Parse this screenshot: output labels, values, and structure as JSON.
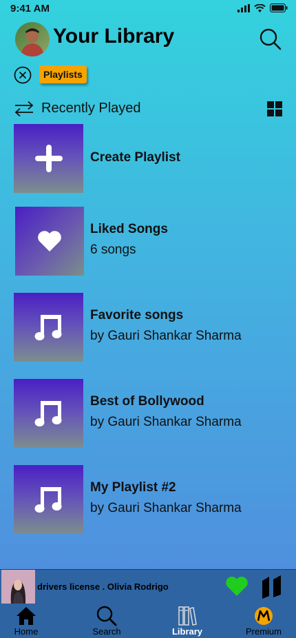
{
  "status_bar": {
    "time": "9:41 AM"
  },
  "header": {
    "title": "Your Library",
    "avatar_icon": "user-avatar",
    "search_icon": "search-icon"
  },
  "filter": {
    "chip_label": "Playlists",
    "clear_icon": "close-circle-icon"
  },
  "sort": {
    "label": "Recently Played",
    "sort_icon": "swap-arrows-icon",
    "view_icon": "grid-view-icon"
  },
  "library_items": [
    {
      "name": "Create Playlist",
      "subtitle": "",
      "icon": "plus-icon"
    },
    {
      "name": "Liked Songs",
      "subtitle": "6 songs",
      "icon": "heart-icon"
    },
    {
      "name": "Favorite songs",
      "subtitle": "by Gauri Shankar Sharma",
      "icon": "music-note-icon"
    },
    {
      "name": "Best of Bollywood",
      "subtitle": "by Gauri Shankar Sharma",
      "icon": "music-note-icon"
    },
    {
      "name": "My Playlist #2",
      "subtitle": "by Gauri Shankar Sharma",
      "icon": "music-note-icon"
    }
  ],
  "now_playing": {
    "track": "drivers license . Olivia Rodrigo",
    "liked": true,
    "like_color": "#1fcc1f"
  },
  "bottom_nav": [
    {
      "label": "Home",
      "icon": "home-icon",
      "active": false
    },
    {
      "label": "Search",
      "icon": "search-icon",
      "active": false
    },
    {
      "label": "Library",
      "icon": "library-icon",
      "active": true
    },
    {
      "label": "Premium",
      "icon": "premium-logo-icon",
      "active": false
    }
  ],
  "colors": {
    "chip": "#f5a300",
    "bar": "#2e64a2",
    "accent_like": "#1fcc1f"
  }
}
